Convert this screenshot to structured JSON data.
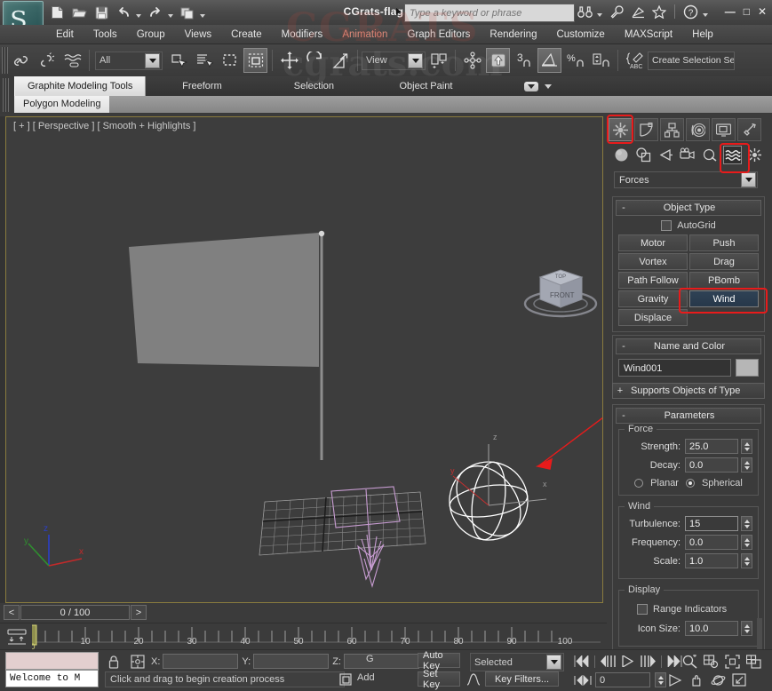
{
  "app": {
    "title": "CGrats-flag.max",
    "logo_glyph": "S",
    "watermark": "CGRATS",
    "watermark2": "cgrats.com"
  },
  "titlebar": {
    "quick_access": [
      {
        "name": "new-file-icon",
        "glyph": "⬜"
      },
      {
        "name": "open-file-icon",
        "glyph": "📂"
      },
      {
        "name": "save-file-icon",
        "glyph": "💾"
      },
      {
        "name": "undo-icon",
        "glyph": "↶"
      },
      {
        "name": "redo-icon",
        "glyph": "↷"
      },
      {
        "name": "set-project-folder-icon",
        "glyph": "🗂"
      }
    ],
    "search_placeholder": "Type a keyword or phrase",
    "search_value": "",
    "right_icons": [
      {
        "name": "binoculars-icon",
        "glyph": "🔍"
      },
      {
        "name": "wrench-icon",
        "glyph": "🔧"
      },
      {
        "name": "satellite-dish-icon",
        "glyph": "📡"
      },
      {
        "name": "favorites-star-icon",
        "glyph": "☆"
      },
      {
        "name": "help-icon",
        "glyph": "?"
      }
    ],
    "window_buttons": [
      {
        "name": "minimize-button",
        "glyph": "—"
      },
      {
        "name": "maximize-button",
        "glyph": "□"
      },
      {
        "name": "close-button",
        "glyph": "✕"
      }
    ]
  },
  "menu": {
    "items": [
      {
        "label": "Edit",
        "highlight": false
      },
      {
        "label": "Tools",
        "highlight": false
      },
      {
        "label": "Group",
        "highlight": false
      },
      {
        "label": "Views",
        "highlight": false
      },
      {
        "label": "Create",
        "highlight": false
      },
      {
        "label": "Modifiers",
        "highlight": false
      },
      {
        "label": "Animation",
        "highlight": true
      },
      {
        "label": "Graph Editors",
        "highlight": false
      },
      {
        "label": "Rendering",
        "highlight": false
      },
      {
        "label": "Customize",
        "highlight": false
      },
      {
        "label": "MAXScript",
        "highlight": false
      },
      {
        "label": "Help",
        "highlight": false
      }
    ]
  },
  "main_toolbar": {
    "icons_left": [
      {
        "name": "select-and-link-icon",
        "glyph": "🔗"
      },
      {
        "name": "unlink-selection-icon",
        "glyph": "✂"
      },
      {
        "name": "bind-to-space-warp-icon",
        "glyph": "≋"
      }
    ],
    "selection_filter_value": "All",
    "icons_mid": [
      {
        "name": "select-object-icon",
        "glyph": "◱"
      },
      {
        "name": "select-by-name-icon",
        "glyph": "☰"
      },
      {
        "name": "rectangular-selection-region-icon",
        "glyph": "⬚"
      },
      {
        "name": "window-crossing-icon",
        "glyph": "▣"
      },
      {
        "name": "select-and-move-icon",
        "glyph": "✥"
      },
      {
        "name": "select-and-rotate-icon",
        "glyph": "↻"
      },
      {
        "name": "select-and-scale-icon",
        "glyph": "↗"
      }
    ],
    "reference_coordinate_value": "View",
    "icons_right": [
      {
        "name": "use-pivot-point-center-icon",
        "glyph": "⧉"
      },
      {
        "name": "select-and-manipulate-icon",
        "glyph": "⚙"
      },
      {
        "name": "snaps-toggle-icon",
        "glyph": "⬆"
      },
      {
        "name": "snap-3-icon",
        "glyph": "3"
      },
      {
        "name": "angle-snap-toggle-icon",
        "glyph": "∠"
      },
      {
        "name": "percent-snap-toggle-icon",
        "glyph": "%"
      },
      {
        "name": "spinner-snap-toggle-icon",
        "glyph": "↕"
      },
      {
        "name": "edit-named-selection-sets-icon",
        "glyph": "✎"
      }
    ],
    "create_selection_set_placeholder": "Create Selection Se"
  },
  "ribbon": {
    "tabs": [
      {
        "label": "Graphite Modeling Tools",
        "active": true
      },
      {
        "label": "Freeform",
        "active": false
      },
      {
        "label": "Selection",
        "active": false
      },
      {
        "label": "Object Paint",
        "active": false
      }
    ],
    "panel_label": "Polygon Modeling"
  },
  "viewport": {
    "label": "[ + ] [ Perspective ] [ Smooth + Highlights ]",
    "viewcube": {
      "front_label": "FRONT",
      "top_label": "TOP"
    },
    "axis_tripod": [
      {
        "axis": "z",
        "color": "#2b3ec9"
      },
      {
        "axis": "y",
        "color": "#2f8f2f"
      },
      {
        "axis": "x",
        "color": "#c22a2a"
      }
    ],
    "gizmo_axes": [
      {
        "label": "z"
      },
      {
        "label": "y"
      },
      {
        "label": "x"
      }
    ],
    "colors": {
      "background": "#3d3d3d",
      "flag_plane": "#808080",
      "grid": "#a8a8a8",
      "gravity_gizmo": "#c79cd1",
      "wind_gizmo": "#ffffff",
      "annotation_arrow": "#e81b1b",
      "viewport_border": "#8a7c3e"
    }
  },
  "command_panel": {
    "tabs": [
      {
        "name": "create-tab",
        "glyph": "✲",
        "selected": true
      },
      {
        "name": "modify-tab",
        "glyph": "◠",
        "selected": false
      },
      {
        "name": "hierarchy-tab",
        "glyph": "⑂",
        "selected": false
      },
      {
        "name": "motion-tab",
        "glyph": "◎",
        "selected": false
      },
      {
        "name": "display-tab",
        "glyph": "▣",
        "selected": false
      },
      {
        "name": "utilities-tab",
        "glyph": "🔨",
        "selected": false
      }
    ],
    "categories": [
      {
        "name": "geometry-category-icon",
        "glyph": "●",
        "selected": false
      },
      {
        "name": "shapes-category-icon",
        "glyph": "❐",
        "selected": false
      },
      {
        "name": "lights-category-icon",
        "glyph": "◢",
        "selected": false
      },
      {
        "name": "cameras-category-icon",
        "glyph": "🎥",
        "selected": false
      },
      {
        "name": "helpers-category-icon",
        "glyph": "⌿",
        "selected": false
      },
      {
        "name": "space-warps-category-icon",
        "glyph": "≋",
        "selected": true
      },
      {
        "name": "systems-category-icon",
        "glyph": "✳",
        "selected": false
      }
    ],
    "subcategory_value": "Forces",
    "object_type": {
      "title": "Object Type",
      "collapse_glyph": "-",
      "autogrid_label": "AutoGrid",
      "autogrid_checked": false,
      "buttons": [
        {
          "label": "Motor",
          "selected": false
        },
        {
          "label": "Push",
          "selected": false
        },
        {
          "label": "Vortex",
          "selected": false
        },
        {
          "label": "Drag",
          "selected": false
        },
        {
          "label": "Path Follow",
          "selected": false
        },
        {
          "label": "PBomb",
          "selected": false
        },
        {
          "label": "Gravity",
          "selected": false
        },
        {
          "label": "Wind",
          "selected": true
        },
        {
          "label": "Displace",
          "selected": false
        }
      ]
    },
    "name_and_color": {
      "title": "Name and Color",
      "collapse_glyph": "-",
      "object_name": "Wind001",
      "color_hex": "#b6b6b6"
    },
    "supports_objects": {
      "title": "Supports Objects of Type",
      "collapse_glyph": "+"
    },
    "parameters": {
      "title": "Parameters",
      "collapse_glyph": "-",
      "force_group": {
        "label": "Force",
        "strength_label": "Strength:",
        "strength_value": "25.0",
        "decay_label": "Decay:",
        "decay_value": "0.0",
        "planar_label": "Planar",
        "spherical_label": "Spherical",
        "selected_mode": "Spherical"
      },
      "wind_group": {
        "label": "Wind",
        "turbulence_label": "Turbulence:",
        "turbulence_value": "15",
        "frequency_label": "Frequency:",
        "frequency_value": "0.0",
        "scale_label": "Scale:",
        "scale_value": "1.0"
      },
      "display_group": {
        "label": "Display",
        "range_indicators_label": "Range Indicators",
        "range_indicators_checked": false,
        "icon_size_label": "Icon Size:",
        "icon_size_value": "10.0"
      }
    }
  },
  "timeline": {
    "prev_frame_glyph": "<",
    "next_frame_glyph": ">",
    "current_frame_display": "0 / 100",
    "slider_position": 0,
    "ticks": [
      {
        "label": "10",
        "value": 10
      },
      {
        "label": "20",
        "value": 20
      },
      {
        "label": "30",
        "value": 30
      },
      {
        "label": "40",
        "value": 40
      },
      {
        "label": "50",
        "value": 50
      },
      {
        "label": "60",
        "value": 60
      },
      {
        "label": "70",
        "value": 70
      },
      {
        "label": "80",
        "value": 80
      },
      {
        "label": "90",
        "value": 90
      },
      {
        "label": "100",
        "value": 100
      }
    ],
    "range_start": 0,
    "range_end": 100
  },
  "status_bar": {
    "maxscript_listener_text": "Welcome to M",
    "lock_icon": "lock-selection-icon",
    "absolute_mode_icon": "absolute-relative-transform-icon",
    "coordinates": [
      {
        "label": "X:",
        "value": ""
      },
      {
        "label": "Y:",
        "value": ""
      },
      {
        "label": "Z:",
        "value": ""
      }
    ],
    "grid_label": "G",
    "prompt_text": "Click and drag to begin creation process",
    "add_time_tag_label": "Add",
    "auto_key_label": "Auto Key",
    "set_key_label": "Set Key",
    "key_mode_value": "Selected",
    "key_filters_label": "Key Filters...",
    "current_frame_value": "0",
    "playback_icons": [
      {
        "name": "go-to-start-icon",
        "glyph": "⏮"
      },
      {
        "name": "previous-frame-icon",
        "glyph": "⏪"
      },
      {
        "name": "play-animation-icon",
        "glyph": "▶"
      },
      {
        "name": "next-frame-icon",
        "glyph": "⏩"
      },
      {
        "name": "go-to-end-icon",
        "glyph": "⏭"
      }
    ],
    "nav_icons": [
      {
        "name": "zoom-icon",
        "glyph": "🔍"
      },
      {
        "name": "zoom-all-icon",
        "glyph": "⊞"
      },
      {
        "name": "zoom-extents-icon",
        "glyph": "⬚"
      },
      {
        "name": "zoom-extents-all-icon",
        "glyph": "⧉"
      },
      {
        "name": "field-of-view-icon",
        "glyph": "▷"
      },
      {
        "name": "pan-view-icon",
        "glyph": "✋"
      },
      {
        "name": "orbit-icon",
        "glyph": "⟳"
      },
      {
        "name": "maximize-viewport-toggle-icon",
        "glyph": "⤡"
      }
    ]
  },
  "annotations": {
    "highlight_color": "#e81b1b",
    "boxes": [
      {
        "name": "create-tab-highlight"
      },
      {
        "name": "space-warps-category-highlight"
      },
      {
        "name": "wind-button-highlight"
      }
    ]
  }
}
